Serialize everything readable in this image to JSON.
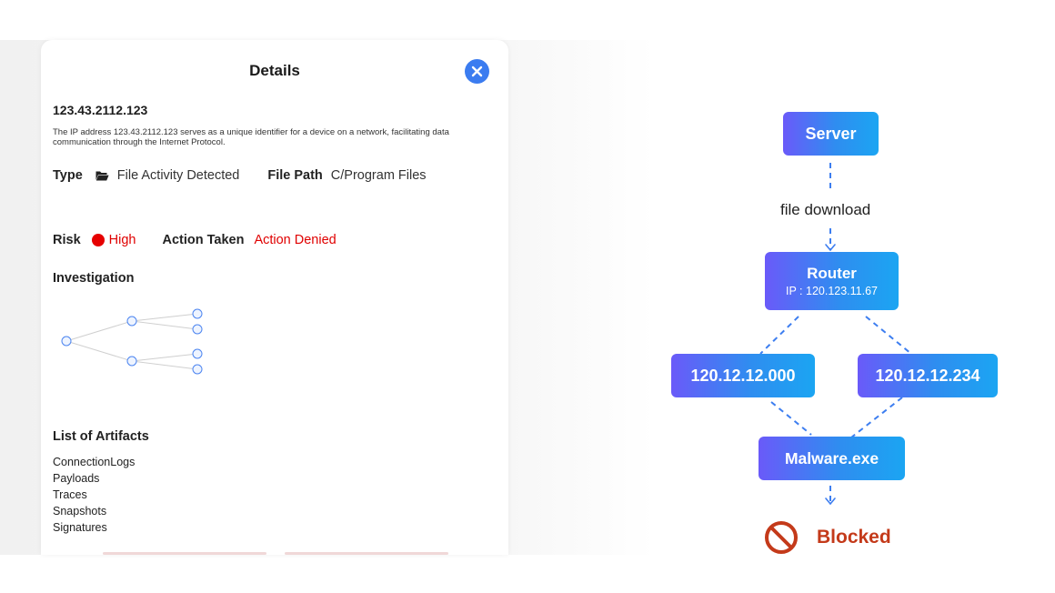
{
  "details": {
    "title": "Details",
    "ip": "123.43.2112.123",
    "description": "The IP address 123.43.2112.123 serves as a unique identifier for a device on a network, facilitating data communication through the Internet Protocol.",
    "type_label": "Type",
    "type_icon": "folder-open-icon",
    "type_value": "File Activity Detected",
    "file_path_label": "File Path",
    "file_path_value": "C/Program Files",
    "risk_label": "Risk",
    "risk_value": "High",
    "risk_color": "#e60000",
    "action_label": "Action Taken",
    "action_value": "Action Denied",
    "investigation_title": "Investigation",
    "artifacts_title": "List of Artifacts",
    "artifacts": [
      "ConnectionLogs",
      "Payloads",
      "Traces",
      "Snapshots",
      "Signatures"
    ],
    "close_icon": "close-icon",
    "accent": "#3b7cf0"
  },
  "flow": {
    "server": "Server",
    "edge_label": "file download",
    "router": "Router",
    "router_ip": "IP : 120.123.11.67",
    "host_1": "120.12.12.000",
    "host_2": "120.12.12.234",
    "malware": "Malware.exe",
    "result": "Blocked",
    "result_icon": "blocked-icon",
    "result_color": "#c43a1a",
    "node_gradient": [
      "#6a5af9",
      "#2f8df0",
      "#1ba5f2"
    ]
  }
}
